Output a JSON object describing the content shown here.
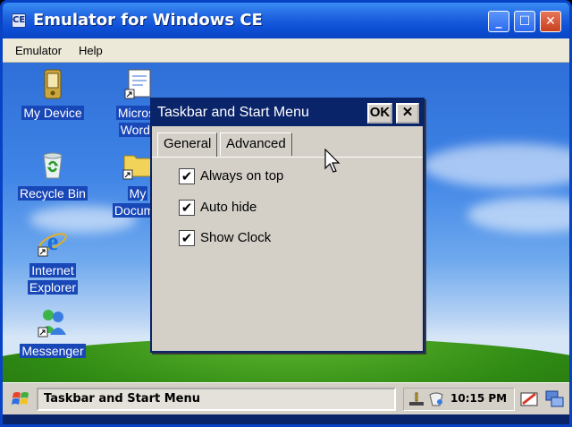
{
  "window": {
    "title": "Emulator for Windows CE",
    "title_icon": "CE"
  },
  "menubar": {
    "items": [
      "Emulator",
      "Help"
    ]
  },
  "desktop_icons": [
    {
      "label": "My Device",
      "icon": "pda-device-icon"
    },
    {
      "label": "Recycle Bin",
      "icon": "recycle-bin-icon"
    },
    {
      "label": "Internet",
      "label2": "Explorer",
      "icon": "internet-explorer-icon"
    },
    {
      "label": "Messenger",
      "icon": "messenger-icon"
    },
    {
      "label": "Microsc",
      "label2": "WordP",
      "icon": "wordpad-shortcut-icon"
    },
    {
      "label": "My",
      "label2": "Docume",
      "icon": "my-documents-folder-icon"
    }
  ],
  "dialog": {
    "title": "Taskbar and Start Menu",
    "ok_label": "OK",
    "close_label": "✕",
    "tabs": [
      "General",
      "Advanced"
    ],
    "active_tab": "General",
    "options": [
      {
        "label": "Always on top",
        "checked": true
      },
      {
        "label": "Auto hide",
        "checked": true
      },
      {
        "label": "Show Clock",
        "checked": true
      }
    ]
  },
  "taskbar": {
    "task_label": "Taskbar and Start Menu",
    "clock": "10:15 PM"
  },
  "colors": {
    "xp_title_blue": "#1f64e0",
    "ce_title_navy": "#0a246a",
    "dialog_gray": "#d4d0c8",
    "desktop_blue": "#3f84e6",
    "hill_green": "#2f8a14"
  }
}
